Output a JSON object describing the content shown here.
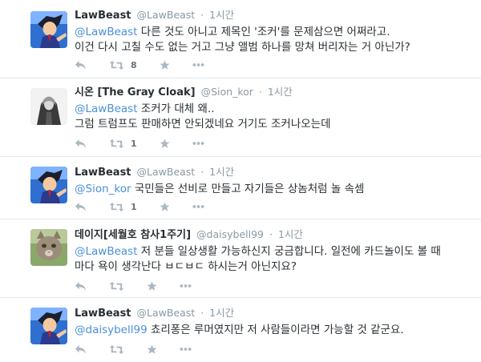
{
  "tweets": [
    {
      "display_name": "LawBeast",
      "screen_name": "@LawBeast",
      "time": "1시간",
      "mention": "@LawBeast",
      "text": " 다른 것도 아니고 제목인 '조커'를 문제삼으면 어쩌라고.",
      "text2": "이건 다시 고칠 수도 없는 거고 그냥 앨범 하나를 망쳐 버리자는 거 아닌가?",
      "retweet_count": "8",
      "avatar_icon": "phoenix-wright-avatar"
    },
    {
      "display_name": "시온 [The Gray Cloak]",
      "screen_name": "@Sion_kor",
      "time": "1시간",
      "mention": "@LawBeast",
      "text": " 조커가 대체 왜..",
      "text2": "그럼 트럼프도 판매하면 안되겠네요 거기도 조커나오는데",
      "retweet_count": "1",
      "avatar_icon": "gray-cloak-avatar"
    },
    {
      "display_name": "LawBeast",
      "screen_name": "@LawBeast",
      "time": "1시간",
      "mention": "@Sion_kor",
      "text": " 국민들은 선비로 만들고 자기들은 상놈처럼 놀 속셈",
      "retweet_count": "1",
      "avatar_icon": "phoenix-wright-avatar"
    },
    {
      "display_name": "데이지[세월호 참사1주기]",
      "screen_name": "@daisybell99",
      "time": "1시간",
      "mention": "@LawBeast",
      "text": " 저 분들 일상생활 가능하신지 궁금합니다.  일전에 카드놀이도 볼 때",
      "text2": "마다 욕이 생각난다 ㅂㄷㅂㄷ 하시는거 아닌지요?",
      "retweet_count": "",
      "avatar_icon": "cat-avatar"
    },
    {
      "display_name": "LawBeast",
      "screen_name": "@LawBeast",
      "time": "1시간",
      "mention": "@daisybell99",
      "text": " 쵸리퐁은 루머였지만 저 사람들이라면 가능할 것 같군요.",
      "retweet_count": "",
      "avatar_icon": "phoenix-wright-avatar"
    }
  ],
  "colors": {
    "link": "#4a90d9",
    "muted": "#8899a6",
    "action": "#aab8c2",
    "border": "#e1e8ed"
  },
  "icons": {
    "reply": "reply-icon",
    "retweet": "retweet-icon",
    "favorite": "favorite-icon",
    "more": "more-icon"
  },
  "separator": "·"
}
